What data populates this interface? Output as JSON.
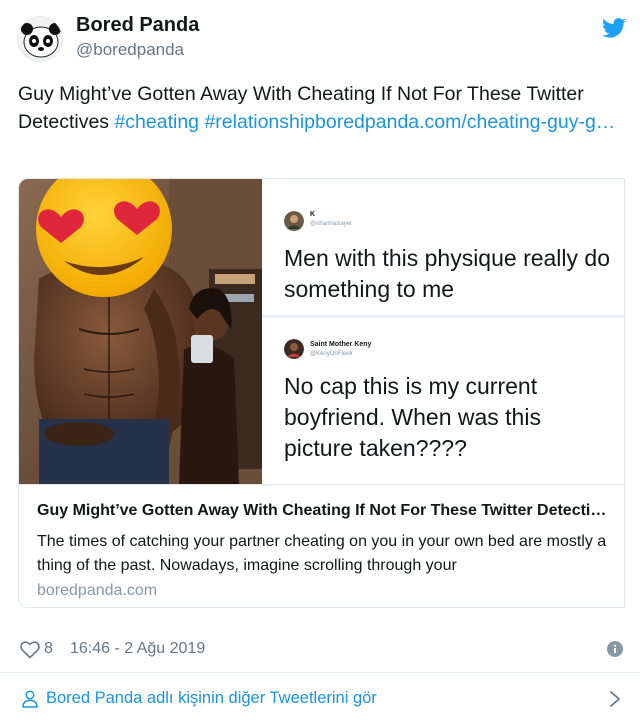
{
  "author": {
    "name": "Bored Panda",
    "handle": "@boredpanda"
  },
  "tweet": {
    "text_plain": "Guy Might’ve Gotten Away With Cheating If Not For These Twitter Detectives ",
    "hashtag_1": "#cheating",
    "hashtag_2": "#relationship",
    "link_text": "boredpanda.com/cheating-guy-g…"
  },
  "card": {
    "panel_1": {
      "name": "K",
      "handle": "@rihannaslayer",
      "text": "Men with this physique really do something to me"
    },
    "panel_2": {
      "name": "Saint Mother Keny",
      "handle": "@KenyOnFleek",
      "text": "No cap this is my current boyfriend. When was this picture taken????"
    },
    "title": "Guy Might’ve Gotten Away With Cheating If Not For These Twitter Detectives",
    "description": "The times of catching your partner cheating on you in your own bed are mostly a thing of the past. Nowadays, imagine scrolling through your",
    "domain": "boredpanda.com"
  },
  "footer": {
    "like_count": "8",
    "timestamp": "16:46 - 2 Ağu 2019",
    "more_tweets": "Bored Panda adlı kişinin diğer Tweetlerini gör"
  },
  "colors": {
    "link": "#1b95e0",
    "text": "#14171a",
    "muted": "#657786"
  },
  "icons": [
    "panda-avatar",
    "twitter-bird-icon",
    "heart-icon",
    "info-icon",
    "person-icon",
    "chevron-right-icon"
  ]
}
